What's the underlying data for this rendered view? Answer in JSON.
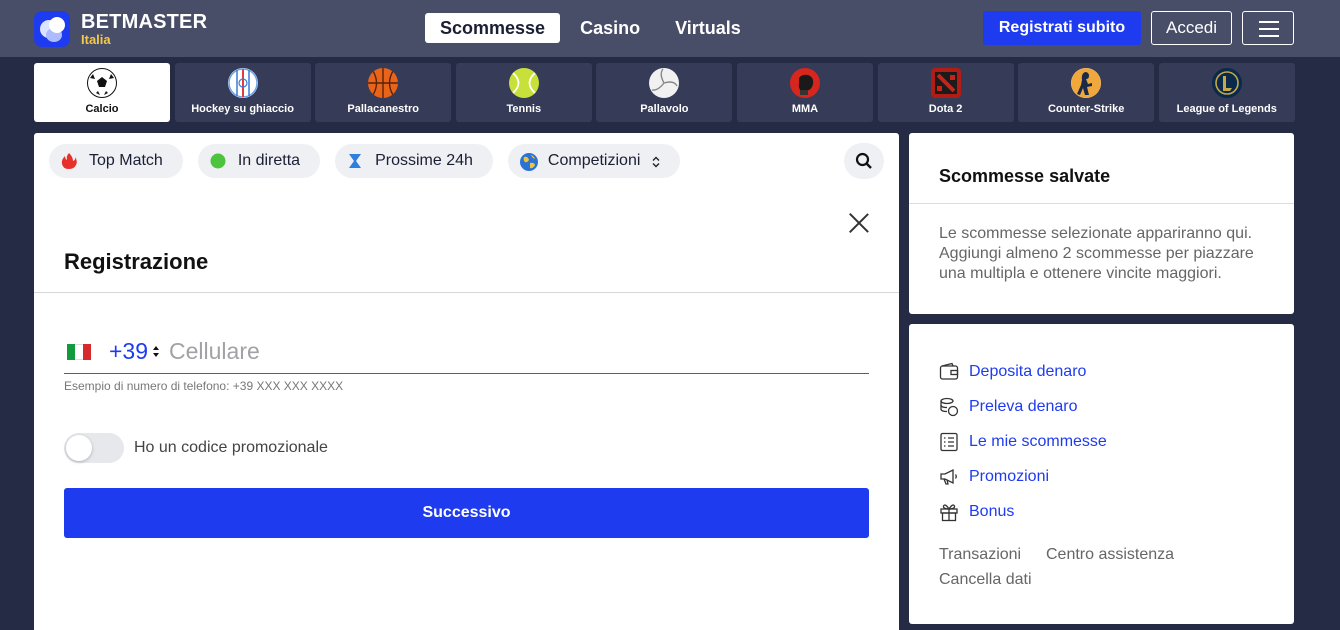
{
  "brand": {
    "name": "BETMASTER",
    "sub": "Italia"
  },
  "nav": {
    "items": [
      "Scommesse",
      "Casino",
      "Virtuals"
    ],
    "active": "Scommesse"
  },
  "header_actions": {
    "register": "Registrati subito",
    "login": "Accedi"
  },
  "sports": [
    {
      "label": "Calcio",
      "icon": "soccer-ball-icon",
      "active": true
    },
    {
      "label": "Hockey su ghiaccio",
      "icon": "ice-hockey-rink-icon"
    },
    {
      "label": "Pallacanestro",
      "icon": "basketball-icon"
    },
    {
      "label": "Tennis",
      "icon": "tennis-ball-icon"
    },
    {
      "label": "Pallavolo",
      "icon": "volleyball-icon"
    },
    {
      "label": "MMA",
      "icon": "mma-glove-icon"
    },
    {
      "label": "Dota 2",
      "icon": "dota2-logo-icon"
    },
    {
      "label": "Counter-Strike",
      "icon": "counter-strike-icon"
    },
    {
      "label": "League of Legends",
      "icon": "league-of-legends-icon"
    }
  ],
  "filters": [
    {
      "label": "Top Match",
      "icon": "flame-icon"
    },
    {
      "label": "In diretta",
      "icon": "live-dot-icon"
    },
    {
      "label": "Prossime 24h",
      "icon": "hourglass-icon"
    },
    {
      "label": "Competizioni",
      "icon": "globe-icon"
    }
  ],
  "registration": {
    "title": "Registrazione",
    "country_code": "+39",
    "phone_placeholder": "Cellulare",
    "phone_hint": "Esempio di numero di telefono: +39 XXX XXX XXXX",
    "promo_label": "Ho un codice promozionale",
    "promo_enabled": false,
    "next_button": "Successivo"
  },
  "betslip": {
    "title": "Scommesse salvate",
    "text": "Le scommesse selezionate appariranno qui. Aggiungi almeno 2 scommesse per piazzare una multipla e ottenere vincite maggiori."
  },
  "account_links": [
    {
      "label": "Deposita denaro",
      "icon": "wallet-icon"
    },
    {
      "label": "Preleva denaro",
      "icon": "coins-icon"
    },
    {
      "label": "Le mie scommesse",
      "icon": "list-icon"
    },
    {
      "label": "Promozioni",
      "icon": "megaphone-icon"
    },
    {
      "label": "Bonus",
      "icon": "gift-icon"
    }
  ],
  "footer_links": [
    "Transazioni",
    "Centro assistenza",
    "Cancella dati"
  ],
  "colors": {
    "accent": "#1f3bf0",
    "header_bg": "#484d68",
    "page_bg": "#252a45",
    "logo_sub": "#f2c94c"
  }
}
